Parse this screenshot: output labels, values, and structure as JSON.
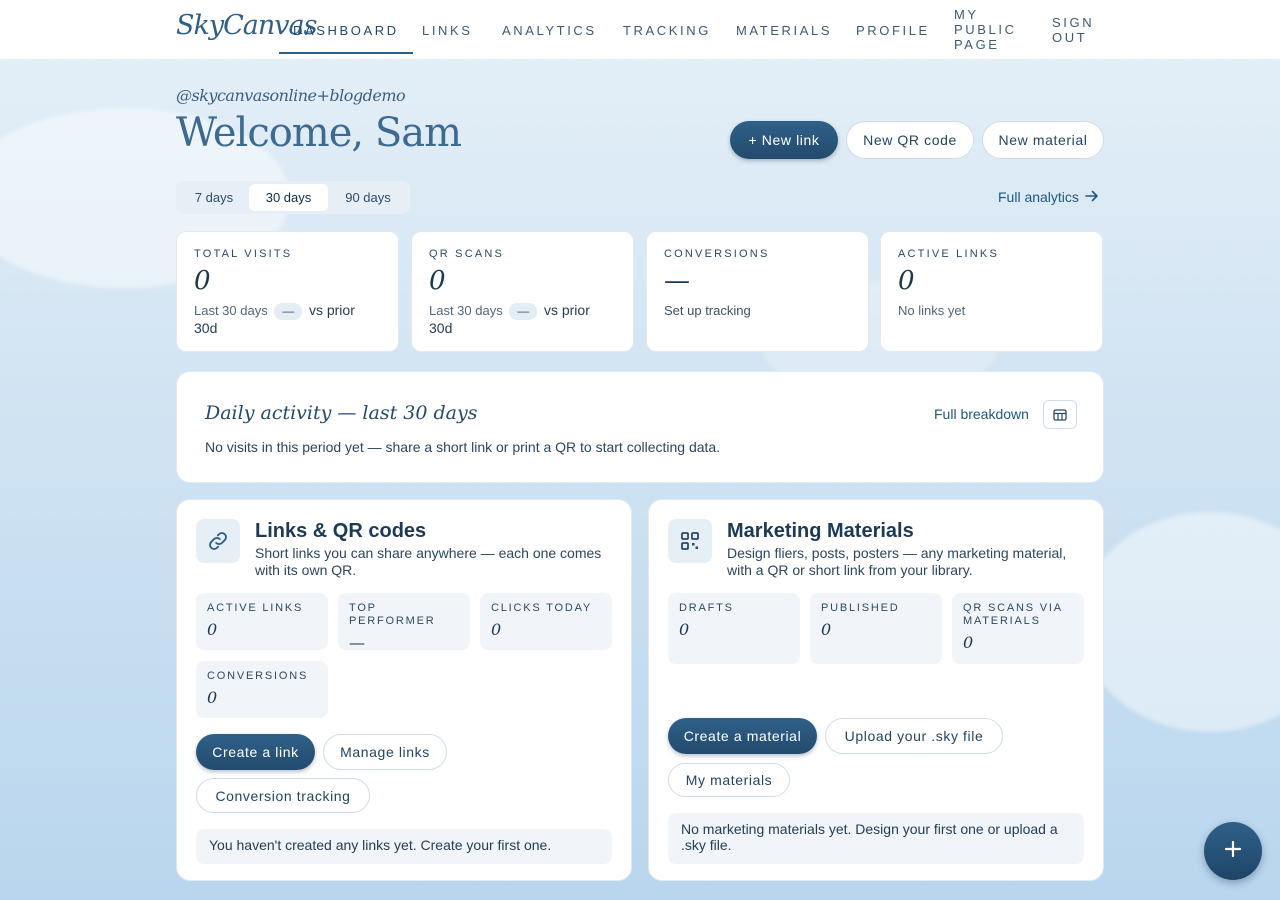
{
  "nav": {
    "logo": "SkyCanvas",
    "items": [
      {
        "label": "DASHBOARD"
      },
      {
        "label": "LINKS"
      },
      {
        "label": "ANALYTICS"
      },
      {
        "label": "TRACKING"
      },
      {
        "label": "MATERIALS"
      },
      {
        "label": "PROFILE"
      },
      {
        "line1": "MY",
        "line2": "PUBLIC",
        "line3": "PAGE"
      },
      {
        "line1": "SIGN",
        "line2": "OUT"
      }
    ]
  },
  "header": {
    "handle": "@skycanvasonline+blogdemo",
    "welcome": "Welcome, Sam",
    "new_link": "+ New link",
    "new_qr": "New QR code",
    "new_material": "New material"
  },
  "period": {
    "options": [
      "7 days",
      "30 days",
      "90 days"
    ],
    "selected": "30 days"
  },
  "full_analytics": "Full analytics",
  "stats": [
    {
      "label": "TOTAL VISITS",
      "value": "0",
      "sub_a": "Last 30 days",
      "pill": "—",
      "sub_b": "vs prior",
      "sub_c": "30d"
    },
    {
      "label": "QR SCANS",
      "value": "0",
      "sub_a": "Last 30 days",
      "pill": "—",
      "sub_b": "vs prior",
      "sub_c": "30d"
    },
    {
      "label": "CONVERSIONS",
      "value": "—",
      "sub": "Set up tracking"
    },
    {
      "label": "ACTIVE LINKS",
      "value": "0",
      "sub": "No links yet"
    }
  ],
  "activity": {
    "title": "Daily activity — last 30 days",
    "desc": "No visits in this period yet — share a short link or print a QR to start collecting data.",
    "link": "Full breakdown"
  },
  "links_panel": {
    "title": "Links & QR codes",
    "desc": "Short links you can share anywhere — each one comes with its own QR.",
    "tiles": [
      {
        "label": "ACTIVE LINKS",
        "value": "0"
      },
      {
        "label": "TOP PERFORMER",
        "value": "—"
      },
      {
        "label": "CLICKS TODAY",
        "value": "0"
      },
      {
        "label": "CONVERSIONS",
        "value": "0"
      }
    ],
    "create": "Create a link",
    "manage": "Manage links",
    "tracking": "Conversion tracking",
    "note": "You haven't created any links yet. Create your first one."
  },
  "materials_panel": {
    "title": "Marketing Materials",
    "desc": "Design fliers, posts, posters — any marketing material, with a QR or short link from your library.",
    "tiles": [
      {
        "label": "DRAFTS",
        "value": "0"
      },
      {
        "label": "PUBLISHED",
        "value": "0"
      },
      {
        "label": "QR SCANS VIA MATERIALS",
        "value": "0"
      }
    ],
    "create": "Create a material",
    "upload": "Upload your .sky file",
    "mine": "My materials",
    "note": "No marketing materials yet. Design your first one or upload a .sky file."
  },
  "colors": {
    "accent": "#2c5d86",
    "link": "#1f5782",
    "panel": "#ffffff"
  },
  "icons": [
    "link-icon",
    "qr-grid-icon",
    "table-icon",
    "arrow-right-icon",
    "plus-icon"
  ]
}
